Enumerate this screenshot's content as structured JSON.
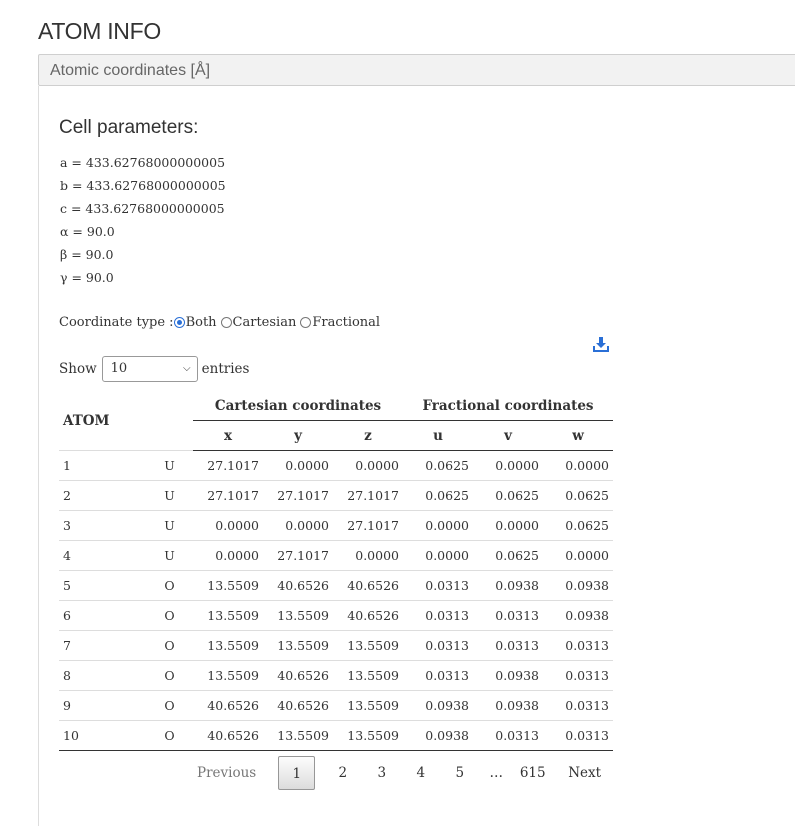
{
  "page_title": "ATOM INFO",
  "panel": {
    "heading": "Atomic coordinates [Å]"
  },
  "cell": {
    "title": "Cell parameters:",
    "params": [
      "a = 433.62768000000005",
      "b = 433.62768000000005",
      "c = 433.62768000000005",
      "α = 90.0",
      "β = 90.0",
      "γ = 90.0"
    ]
  },
  "coordinate_type": {
    "label": "Coordinate type :",
    "options": [
      "Both",
      "Cartesian",
      "Fractional"
    ],
    "selected": "Both"
  },
  "icons": {
    "download": "download-icon",
    "accent": "#2a6fd6"
  },
  "length": {
    "show": "Show",
    "value": "10",
    "entries": "entries"
  },
  "table": {
    "atom_header": "ATOM",
    "cart_header": "Cartesian coordinates",
    "frac_header": "Fractional coordinates",
    "cols": [
      "x",
      "y",
      "z",
      "u",
      "v",
      "w"
    ],
    "rows": [
      [
        "1",
        "U",
        "27.1017",
        "0.0000",
        "0.0000",
        "0.0625",
        "0.0000",
        "0.0000"
      ],
      [
        "2",
        "U",
        "27.1017",
        "27.1017",
        "27.1017",
        "0.0625",
        "0.0625",
        "0.0625"
      ],
      [
        "3",
        "U",
        "0.0000",
        "0.0000",
        "27.1017",
        "0.0000",
        "0.0000",
        "0.0625"
      ],
      [
        "4",
        "U",
        "0.0000",
        "27.1017",
        "0.0000",
        "0.0000",
        "0.0625",
        "0.0000"
      ],
      [
        "5",
        "O",
        "13.5509",
        "40.6526",
        "40.6526",
        "0.0313",
        "0.0938",
        "0.0938"
      ],
      [
        "6",
        "O",
        "13.5509",
        "13.5509",
        "40.6526",
        "0.0313",
        "0.0313",
        "0.0938"
      ],
      [
        "7",
        "O",
        "13.5509",
        "13.5509",
        "13.5509",
        "0.0313",
        "0.0313",
        "0.0313"
      ],
      [
        "8",
        "O",
        "13.5509",
        "40.6526",
        "13.5509",
        "0.0313",
        "0.0938",
        "0.0313"
      ],
      [
        "9",
        "O",
        "40.6526",
        "40.6526",
        "13.5509",
        "0.0938",
        "0.0938",
        "0.0313"
      ],
      [
        "10",
        "O",
        "40.6526",
        "13.5509",
        "13.5509",
        "0.0938",
        "0.0313",
        "0.0313"
      ]
    ]
  },
  "pagination": {
    "previous": "Previous",
    "pages": [
      "1",
      "2",
      "3",
      "4",
      "5"
    ],
    "ellipsis": "…",
    "last": "615",
    "next": "Next",
    "current": "1"
  }
}
